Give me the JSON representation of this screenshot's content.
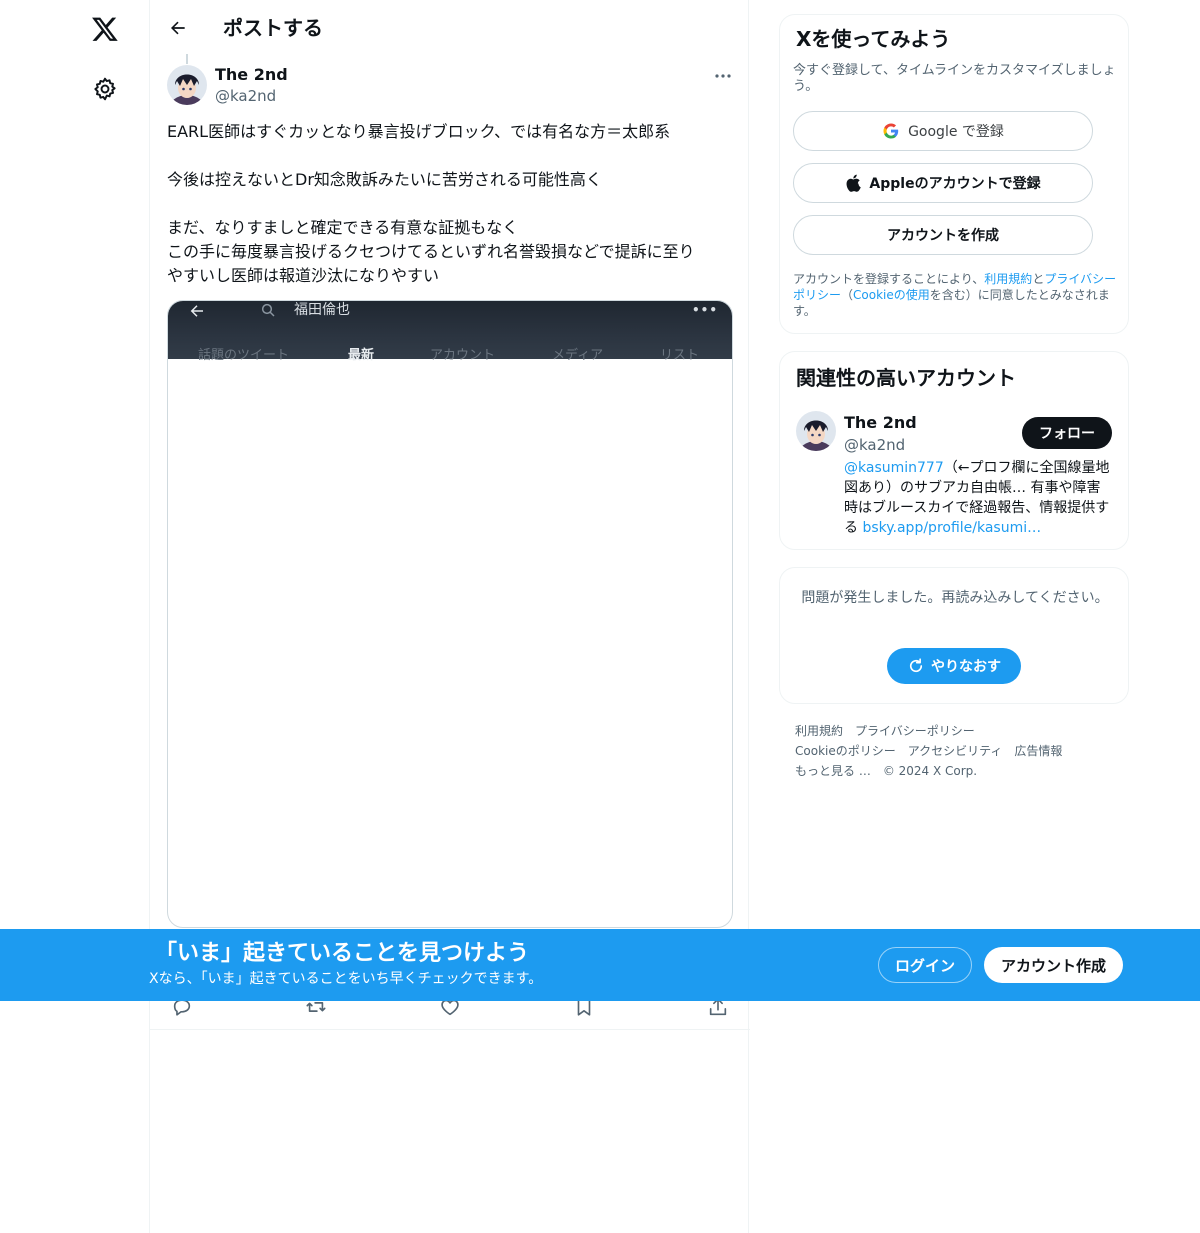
{
  "header": {
    "title": "ポストする"
  },
  "post": {
    "author": {
      "name": "The 2nd",
      "handle": "@ka2nd"
    },
    "text_lines": [
      "EARL医師はすぐカッとなり暴言投げブロック、では有名な方＝太郎系",
      "",
      "今後は控えないとDr知念敗訴みたいに苦労される可能性高く",
      "",
      "まだ、なりすましと確定できる有意な証拠もなく",
      "この手に毎度暴言投げるクセつけてるといずれ名誉毀損などで提訴に至り",
      "やすいし医師は報道沙汰になりやすい"
    ],
    "media": {
      "search_query": "福田倫也",
      "tabs": [
        "話題のツイート",
        "最新",
        "アカウント",
        "メディア",
        "リスト"
      ],
      "active_tab": "最新"
    },
    "actions": [
      "reply-icon",
      "repost-icon",
      "like-icon",
      "bookmark-icon",
      "share-icon"
    ]
  },
  "signup_card": {
    "title": "Xを使ってみよう",
    "description": "今すぐ登録して、タイムラインをカスタマイズしましょう。",
    "google_label": "Google で登録",
    "apple_label": "Appleのアカウントで登録",
    "create_label": "アカウントを作成",
    "terms_prefix": "アカウントを登録することにより、",
    "terms_link": "利用規約",
    "terms_and": "と",
    "privacy_link": "プライバシーポリシー",
    "terms_paren_open": "（",
    "cookie_link": "Cookieの使用",
    "terms_suffix": "を含む）に同意したとみなされます。"
  },
  "related_card": {
    "title": "関連性の高いアカウント",
    "name": "The 2nd",
    "handle": "@ka2nd",
    "follow_label": "フォロー",
    "bio_mention": "@kasumin777",
    "bio_text": "（←プロフ欄に全国線量地図あり）のサブアカ自由帳… 有事や障害時はブルースカイで経過報告、情報提供する ",
    "bio_link": "bsky.app/profile/kasumi…"
  },
  "error_card": {
    "message": "問題が発生しました。再読み込みしてください。",
    "retry_label": "やりなおす"
  },
  "footer": {
    "links": [
      "利用規約",
      "プライバシーポリシー",
      "Cookieのポリシー",
      "アクセシビリティ",
      "広告情報",
      "もっと見る …"
    ],
    "copyright": "© 2024 X Corp."
  },
  "banner": {
    "title": "「いま」起きていることを見つけよう",
    "subtitle": "Xなら、「いま」起きていることをいち早くチェックできます。",
    "login_label": "ログイン",
    "signup_label": "アカウント作成"
  },
  "colors": {
    "accent": "#1d9bf0",
    "text": "#0f1419",
    "secondary": "#536471",
    "border": "#eff3f4"
  }
}
